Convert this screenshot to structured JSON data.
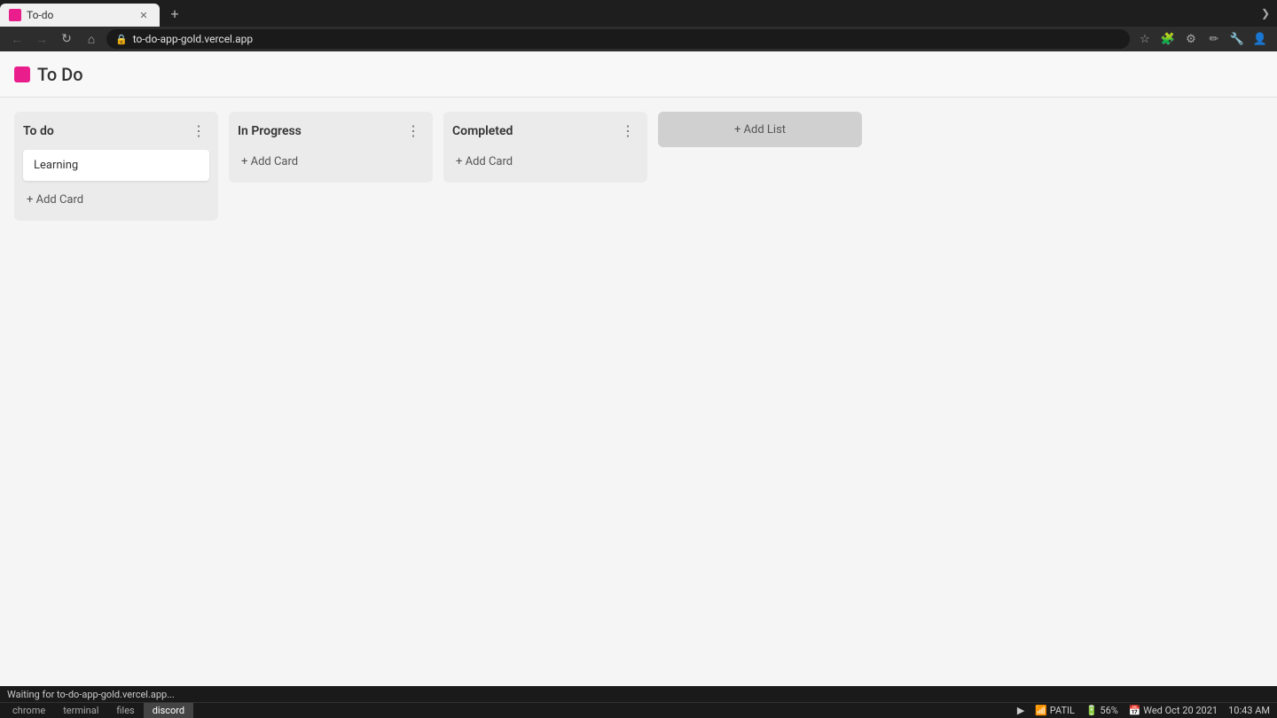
{
  "browser": {
    "tab_title": "To-do",
    "url": "to-do-app-gold.vercel.app",
    "new_tab_icon": "+",
    "chevron_icon": "❯",
    "back_icon": "←",
    "forward_icon": "→",
    "reload_icon": "↻",
    "home_icon": "⌂",
    "star_icon": "☆"
  },
  "app": {
    "title": "To Do",
    "logo_icon": "bookmark"
  },
  "board": {
    "lists": [
      {
        "id": "todo",
        "title": "To do",
        "cards": [
          {
            "id": "card1",
            "text": "Learning"
          }
        ],
        "add_card_label": "+ Add Card"
      },
      {
        "id": "inprogress",
        "title": "In Progress",
        "cards": [],
        "add_card_label": "+ Add Card"
      },
      {
        "id": "completed",
        "title": "Completed",
        "cards": [],
        "add_card_label": "+ Add Card"
      }
    ],
    "add_list_label": "+ Add List"
  },
  "statusbar": {
    "message": "Waiting for to-do-app-gold.vercel.app...",
    "battery_icon": "▶",
    "wifi_label": "PATIL",
    "battery_label": "56%",
    "datetime": "Wed Oct 20 2021",
    "time": "10:43 AM"
  },
  "taskbar": {
    "apps": [
      {
        "label": "chrome",
        "active": false
      },
      {
        "label": "terminal",
        "active": false
      },
      {
        "label": "files",
        "active": false
      },
      {
        "label": "discord",
        "active": true
      }
    ]
  }
}
